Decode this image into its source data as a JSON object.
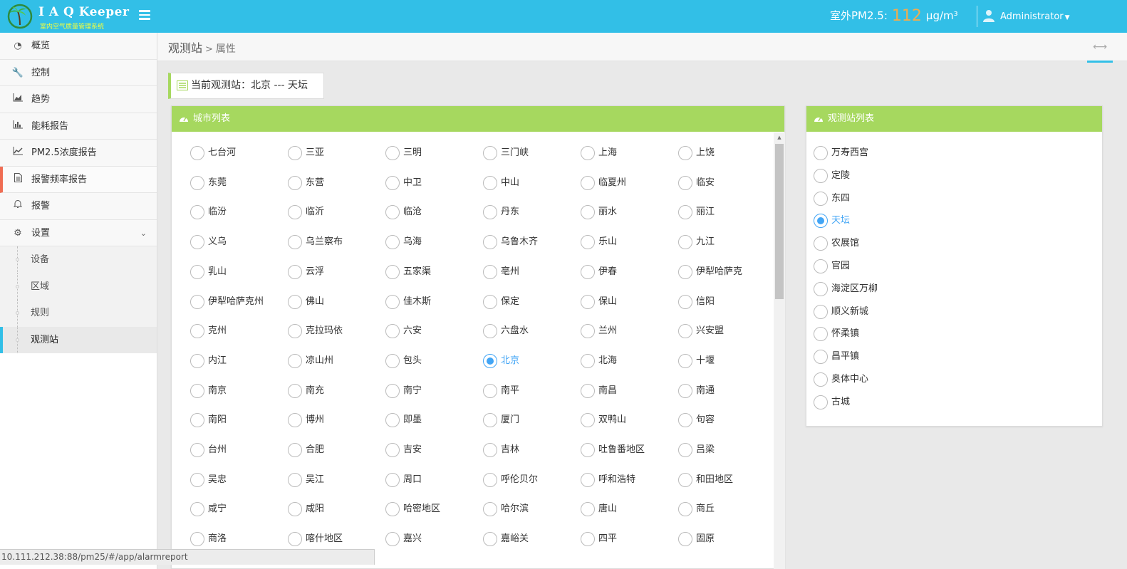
{
  "header": {
    "logo_title": "I A Q Keeper",
    "logo_subtitle": "室内空气质量管理系统",
    "pm_label": "室外PM2.5:",
    "pm_value": "112",
    "pm_unit": "μg/m³",
    "user": "Administrator"
  },
  "sidebar": {
    "items": [
      {
        "label": "概览",
        "icon": "dashboard-icon"
      },
      {
        "label": "控制",
        "icon": "wrench-icon"
      },
      {
        "label": "趋势",
        "icon": "area-chart-icon"
      },
      {
        "label": "能耗报告",
        "icon": "bar-chart-icon"
      },
      {
        "label": "PM2.5浓度报告",
        "icon": "line-chart-icon"
      },
      {
        "label": "报警频率报告",
        "icon": "document-icon"
      },
      {
        "label": "报警",
        "icon": "bell-icon"
      },
      {
        "label": "设置",
        "icon": "cogs-icon"
      }
    ],
    "active": "报警频率报告",
    "sub_items": [
      "设备",
      "区域",
      "规则",
      "观测站"
    ],
    "active_sub": "观测站"
  },
  "breadcrumb": {
    "parent": "观测站",
    "separator": ">",
    "current": "属性"
  },
  "current_station": {
    "label": "当前观测站：北京 --- 天坛"
  },
  "city_panel": {
    "title": "城市列表",
    "selected": "北京",
    "cities": [
      [
        "七台河",
        "三亚",
        "三明",
        "三门峡",
        "上海",
        "上饶"
      ],
      [
        "东莞",
        "东营",
        "中卫",
        "中山",
        "临夏州",
        "临安"
      ],
      [
        "临汾",
        "临沂",
        "临沧",
        "丹东",
        "丽水",
        "丽江"
      ],
      [
        "义乌",
        "乌兰察布",
        "乌海",
        "乌鲁木齐",
        "乐山",
        "九江"
      ],
      [
        "乳山",
        "云浮",
        "五家渠",
        "亳州",
        "伊春",
        "伊犁哈萨克"
      ],
      [
        "伊犁哈萨克州",
        "佛山",
        "佳木斯",
        "保定",
        "保山",
        "信阳"
      ],
      [
        "克州",
        "克拉玛依",
        "六安",
        "六盘水",
        "兰州",
        "兴安盟"
      ],
      [
        "内江",
        "凉山州",
        "包头",
        "北京",
        "北海",
        "十堰"
      ],
      [
        "南京",
        "南充",
        "南宁",
        "南平",
        "南昌",
        "南通"
      ],
      [
        "南阳",
        "博州",
        "即墨",
        "厦门",
        "双鸭山",
        "句容"
      ],
      [
        "台州",
        "合肥",
        "吉安",
        "吉林",
        "吐鲁番地区",
        "吕梁"
      ],
      [
        "吴忠",
        "吴江",
        "周口",
        "呼伦贝尔",
        "呼和浩特",
        "和田地区"
      ],
      [
        "咸宁",
        "咸阳",
        "哈密地区",
        "哈尔滨",
        "唐山",
        "商丘"
      ],
      [
        "商洛",
        "喀什地区",
        "嘉兴",
        "嘉峪关",
        "四平",
        "固原"
      ]
    ]
  },
  "station_panel": {
    "title": "观测站列表",
    "selected": "天坛",
    "stations": [
      "万寿西宫",
      "定陵",
      "东四",
      "天坛",
      "农展馆",
      "官园",
      "海淀区万柳",
      "顺义新城",
      "怀柔镇",
      "昌平镇",
      "奥体中心",
      "古城"
    ]
  },
  "statusbar": {
    "url": "10.111.212.38:88/pm25/#/app/alarmreport"
  },
  "colors": {
    "header": "#32bfe7",
    "panel_head": "#a6d85f",
    "radio_checked": "#42a5f5",
    "active_marker": "#f06d53",
    "pm_value": "#f0ad4e"
  }
}
